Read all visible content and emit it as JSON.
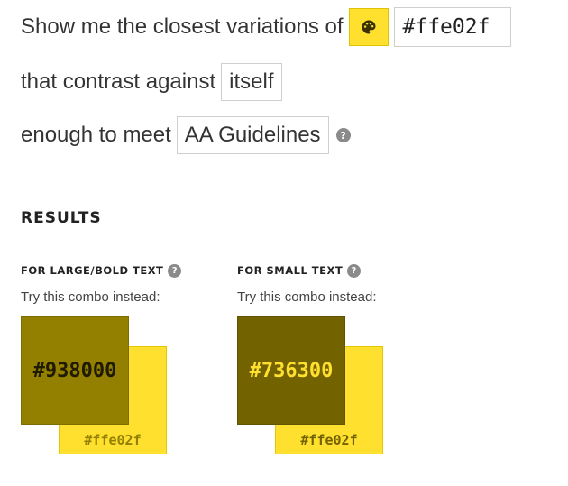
{
  "query": {
    "prefix": "Show me the closest variations of",
    "hex_value": "#ffe02f",
    "contrast_prefix": "that contrast against",
    "contrast_target": "itself",
    "meet_prefix": "enough to meet",
    "guideline": "AA Guidelines",
    "palette_color": "#ffe02f"
  },
  "results": {
    "title": "RESULTS",
    "large": {
      "heading": "FOR LARGE/BOLD TEXT",
      "sub": "Try this combo instead:",
      "front_hex": "#938000",
      "front_color": "#938000",
      "front_text_color": "#1f1a00",
      "back_hex": "#ffe02f",
      "back_color": "#ffe02f",
      "back_text_color": "#938000"
    },
    "small": {
      "heading": "FOR SMALL TEXT",
      "sub": "Try this combo instead:",
      "front_hex": "#736300",
      "front_color": "#736300",
      "front_text_color": "#ffe02f",
      "back_hex": "#ffe02f",
      "back_color": "#ffe02f",
      "back_text_color": "#736300"
    }
  },
  "icons": {
    "palette": "palette-icon",
    "help": "help-icon"
  }
}
